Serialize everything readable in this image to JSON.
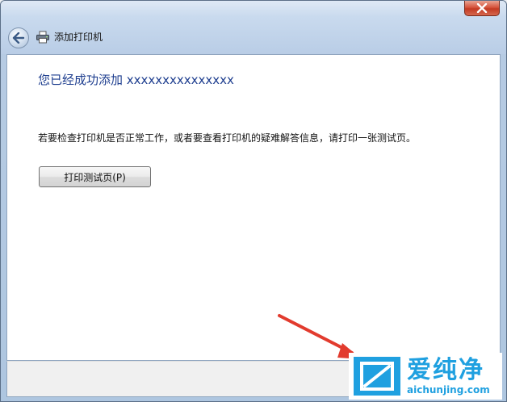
{
  "window": {
    "close_glyph": "×"
  },
  "nav": {
    "title": "添加打印机",
    "back_icon": "back-arrow-icon",
    "printer_icon": "printer-icon"
  },
  "content": {
    "heading": "您已经成功添加 xxxxxxxxxxxxxxx",
    "info": "若要检查打印机是否正常工作，或者要查看打印机的疑难解答信息，请打印一张测试页。",
    "test_button_label": "打印测试页(P)"
  },
  "watermark": {
    "brand": "爱纯净",
    "url": "aichunjing.com"
  },
  "colors": {
    "heading": "#1e3e8f",
    "close_red": "#c33a22",
    "arrow_red": "#e23b2e",
    "watermark_blue": "#1fa0e0"
  }
}
